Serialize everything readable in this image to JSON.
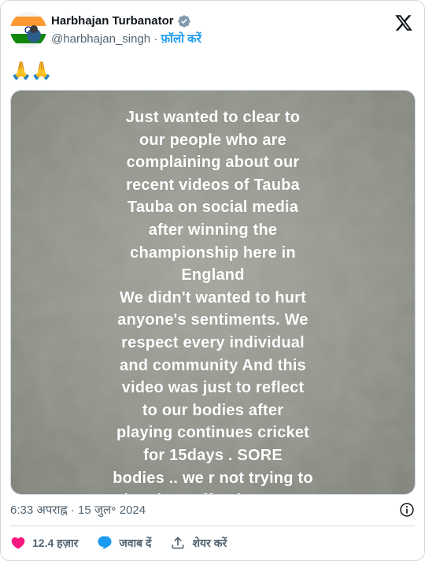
{
  "author": {
    "display_name": "Harbhajan Turbanator",
    "handle": "@harbhajan_singh",
    "separator": "·",
    "follow_label": "फ़ॉलो करें"
  },
  "post": {
    "text": "🙏🙏",
    "media_text_lines": [
      "Just wanted to clear to",
      "our people who are",
      "complaining about our",
      "recent videos of Tauba",
      "Tauba on social  media",
      "after winning the",
      "championship here in",
      "England",
      "We didn't wanted to hurt",
      "anyone's sentiments. We",
      "respect every individual",
      "and community And this",
      "video was just to reflect",
      "to our bodies after",
      "playing continues cricket",
      "for 15days . SORE",
      "bodies .. we r not trying to",
      "insult or offend anyone"
    ],
    "timestamp": "6:33 अपराह्न · 15 जुल॰ 2024"
  },
  "actions": {
    "like_count": "12.4 हज़ार",
    "reply_label": "जवाब दें",
    "share_label": "शेयर करें"
  },
  "colors": {
    "accent": "#1d9bf0",
    "like": "#f91880",
    "muted": "#536471"
  },
  "icons": {
    "verified": "verified-badge-icon",
    "brand": "x-logo-icon",
    "info": "info-icon",
    "like": "heart-icon",
    "reply": "speech-bubble-icon",
    "share": "share-upload-icon"
  }
}
